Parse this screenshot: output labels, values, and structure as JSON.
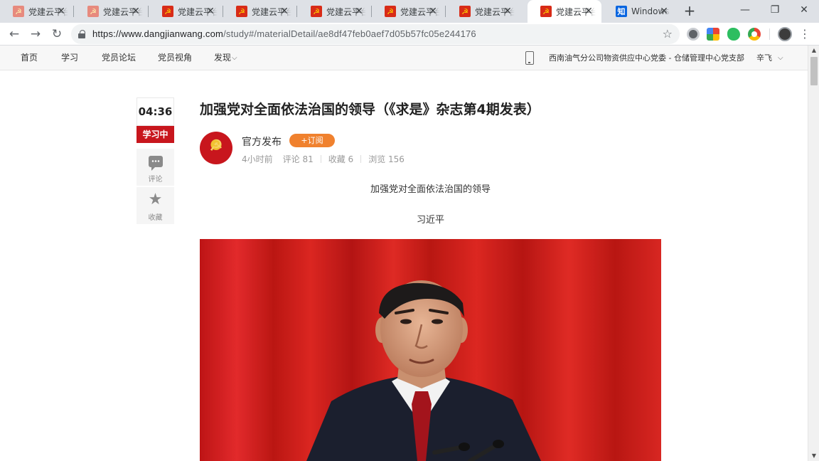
{
  "browser": {
    "tabs": [
      {
        "title": "党建云平台",
        "favicon": "party-emblem-icon",
        "faded": true,
        "close": "✕"
      },
      {
        "title": "党建云平台",
        "favicon": "party-emblem-icon",
        "faded": true,
        "close": "✕"
      },
      {
        "title": "党建云平台",
        "favicon": "party-emblem-icon",
        "faded": false,
        "close": "✕"
      },
      {
        "title": "党建云平台",
        "favicon": "party-emblem-icon",
        "faded": false,
        "close": "✕"
      },
      {
        "title": "党建云平台",
        "favicon": "party-emblem-icon",
        "faded": false,
        "close": "✕"
      },
      {
        "title": "党建云平台",
        "favicon": "party-emblem-icon",
        "faded": false,
        "close": "✕"
      },
      {
        "title": "党建云平台",
        "favicon": "party-emblem-icon",
        "faded": false,
        "close": "✕"
      },
      {
        "title": "党建云平台",
        "favicon": "party-emblem-icon",
        "faded": false,
        "close": "✕",
        "active": true
      },
      {
        "title": "Windows",
        "favicon": "zhihu-icon",
        "faded": false,
        "close": "✕"
      }
    ],
    "favicon_glyph": "☭",
    "zhihu_glyph": "知",
    "new_tab": "+",
    "window_controls": {
      "minimize": "—",
      "restore": "❐",
      "close": "✕"
    },
    "nav": {
      "back": "←",
      "forward": "→",
      "reload": "↻"
    },
    "url": {
      "host": "https://www.dangjianwang.com",
      "path": "/study#/materialDetail/ae8df47feb0aef7d05b57fc05e244176"
    },
    "bookmark_star": "☆",
    "menu": "⋮"
  },
  "site_nav": {
    "links": [
      "首页",
      "学习",
      "党员论坛",
      "党员视角",
      "发现"
    ],
    "discover_caret": "⌵",
    "org": "西南油气分公司物资供应中心党委 - 仓储管理中心党支部",
    "user": "辛飞",
    "user_caret": "⌵"
  },
  "rail": {
    "timer": "04:36",
    "status": "学习中",
    "comment_label": "评论",
    "favorite_label": "收藏",
    "favorite_glyph": "★"
  },
  "article": {
    "title": "加强党对全面依法治国的领导（《求是》杂志第4期发表）",
    "author": "官方发布",
    "subscribe": "+订阅",
    "time": "4小时前",
    "comments": "评论 81",
    "favorites": "收藏 6",
    "views": "浏览 156",
    "sub_heading": "加强党对全面依法治国的领导",
    "byline": "习近平"
  },
  "scrollbar": {
    "up": "▲",
    "down": "▼"
  }
}
